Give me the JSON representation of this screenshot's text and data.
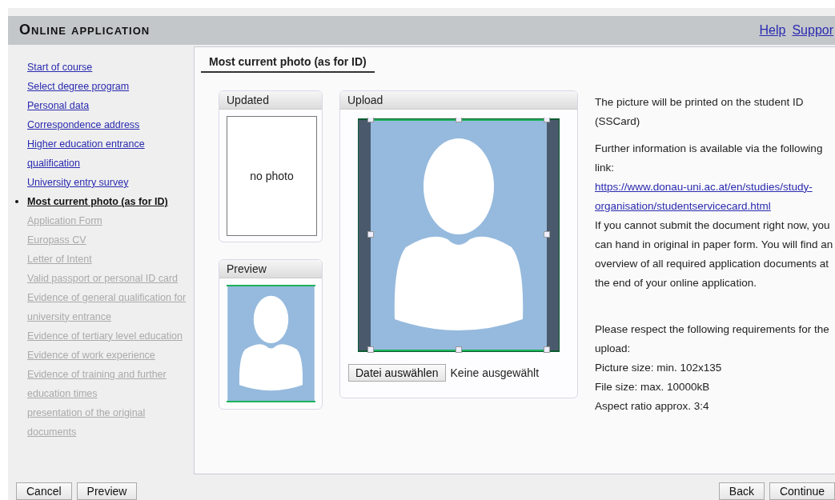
{
  "header": {
    "title": "Online application",
    "links": [
      "Help",
      "Suppor"
    ]
  },
  "sidebar": {
    "items": [
      {
        "label": "Start of course",
        "selected": false,
        "disabled": false
      },
      {
        "label": "Select degree program",
        "selected": false,
        "disabled": false
      },
      {
        "label": "Personal data",
        "selected": false,
        "disabled": false
      },
      {
        "label": "Correspondence address",
        "selected": false,
        "disabled": false
      },
      {
        "label": "Higher education entrance qualification",
        "selected": false,
        "disabled": false
      },
      {
        "label": "University entry survey",
        "selected": false,
        "disabled": false
      },
      {
        "label": "Most current photo (as for ID)",
        "selected": true,
        "disabled": false
      },
      {
        "label": "Application Form",
        "selected": false,
        "disabled": true
      },
      {
        "label": "Europass CV",
        "selected": false,
        "disabled": true
      },
      {
        "label": "Letter of Intent",
        "selected": false,
        "disabled": true
      },
      {
        "label": "Valid passport or personal ID card",
        "selected": false,
        "disabled": true
      },
      {
        "label": "Evidence of general qualification for university entrance",
        "selected": false,
        "disabled": true
      },
      {
        "label": "Evidence of tertiary level education",
        "selected": false,
        "disabled": true
      },
      {
        "label": "Evidence of work experience",
        "selected": false,
        "disabled": true
      },
      {
        "label": "Evidence of training and further education times",
        "selected": false,
        "disabled": true
      },
      {
        "label": "presentation of the original documents",
        "selected": false,
        "disabled": true
      }
    ]
  },
  "section_title": "Most current photo (as for ID)",
  "updated": {
    "title": "Updated",
    "empty_text": "no photo"
  },
  "preview": {
    "title": "Preview"
  },
  "upload": {
    "title": "Upload",
    "file_button": "Datei auswählen",
    "file_status": "Keine ausgewählt"
  },
  "info": {
    "intro": "The picture will be printed on the student ID (SSCard)",
    "further": "Further information is available via the following link:",
    "link": "https://www.donau-uni.ac.at/en/studies/study-organisation/studentservicecard.html",
    "paper": "If you cannot submit the document right now, you can hand in original in paper form. You will find an overview of all required application documents at the end of your online application.",
    "requirements_intro": "Please respect the following requirements for the upload:",
    "requirements": [
      "Picture size: min. 102x135",
      "File size: max. 10000kB",
      "Aspect ratio approx. 3:4"
    ]
  },
  "footer": {
    "left_buttons": [
      "Cancel",
      "Preview"
    ],
    "right_buttons": [
      "Back",
      "Continue"
    ]
  }
}
